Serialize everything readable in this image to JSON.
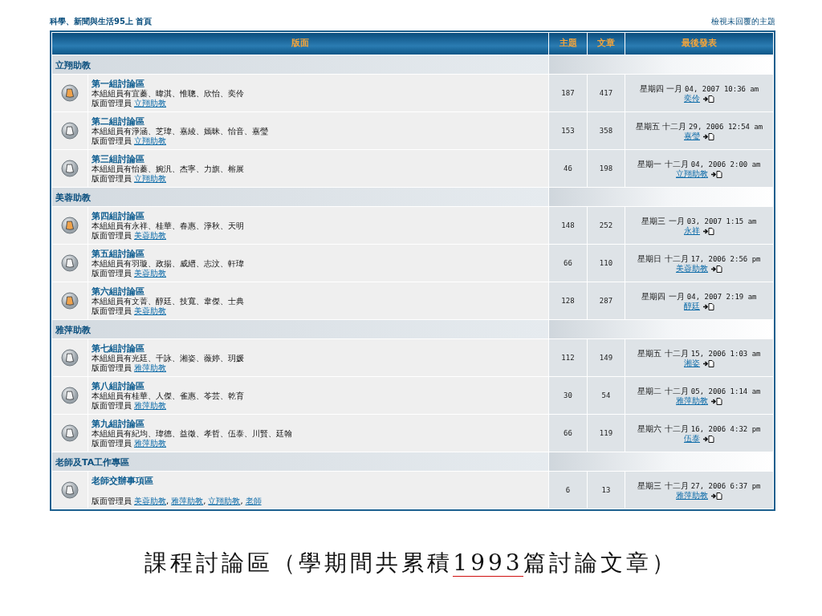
{
  "breadcrumb": "科學、新聞與生活95上 首頁",
  "unanswered_link": "檢視未回覆的主題",
  "table": {
    "columns": [
      "版面",
      "主題",
      "文章",
      "最後發表"
    ],
    "categories": [
      {
        "name": "立翔助教",
        "forums": [
          {
            "title": "第一組討論區",
            "description": "本組組員有宜蓁、暐淇、惟聰、欣怡、奕伶",
            "moderator_label": "版面管理員",
            "moderators": [
              "立翔助教"
            ],
            "topics": "187",
            "posts": "417",
            "last_post_date": "星期四 一月 04, 2007 10:36 am",
            "last_post_author": "奕伶",
            "new_posts": true
          },
          {
            "title": "第二組討論區",
            "description": "本組組員有淨涵、芝瑋、嘉綾、嫣昧、怡音、嘉瑩",
            "moderator_label": "版面管理員",
            "moderators": [
              "立翔助教"
            ],
            "topics": "153",
            "posts": "358",
            "last_post_date": "星期五 十二月 29, 2006 12:54 am",
            "last_post_author": "嘉瑩",
            "new_posts": false
          },
          {
            "title": "第三組討論區",
            "description": "本組組員有怡蓁、婉汎、杰寧、力旗、榕展",
            "moderator_label": "版面管理員",
            "moderators": [
              "立翔助教"
            ],
            "topics": "46",
            "posts": "198",
            "last_post_date": "星期一 十二月 04, 2006 2:00 am",
            "last_post_author": "立翔助教",
            "new_posts": false
          }
        ]
      },
      {
        "name": "美蓉助教",
        "forums": [
          {
            "title": "第四組討論區",
            "description": "本組組員有永祥、桂華、春惠、淨秋、天明",
            "moderator_label": "版面管理員",
            "moderators": [
              "美蓉助教"
            ],
            "topics": "148",
            "posts": "252",
            "last_post_date": "星期三 一月 03, 2007 1:15 am",
            "last_post_author": "永祥",
            "new_posts": true
          },
          {
            "title": "第五組討論區",
            "description": "本組組員有羽璇、政揚、威縉、志汶、軒瑋",
            "moderator_label": "版面管理員",
            "moderators": [
              "美蓉助教"
            ],
            "topics": "66",
            "posts": "110",
            "last_post_date": "星期日 十二月 17, 2006 2:56 pm",
            "last_post_author": "美蓉助教",
            "new_posts": false
          },
          {
            "title": "第六組討論區",
            "description": "本組組員有文菁、醇廷、技寬、韋傑、士典",
            "moderator_label": "版面管理員",
            "moderators": [
              "美蓉助教"
            ],
            "topics": "128",
            "posts": "287",
            "last_post_date": "星期四 一月 04, 2007 2:19 am",
            "last_post_author": "醇廷",
            "new_posts": true
          }
        ]
      },
      {
        "name": "雅萍助教",
        "forums": [
          {
            "title": "第七組討論區",
            "description": "本組組員有光廷、千詠、湘姿、薇婷、玥媛",
            "moderator_label": "版面管理員",
            "moderators": [
              "雅萍助教"
            ],
            "topics": "112",
            "posts": "149",
            "last_post_date": "星期五 十二月 15, 2006 1:03 am",
            "last_post_author": "湘姿",
            "new_posts": false
          },
          {
            "title": "第八組討論區",
            "description": "本組組員有桂華、人傑、雀惠、苓芸、乾育",
            "moderator_label": "版面管理員",
            "moderators": [
              "雅萍助教"
            ],
            "topics": "30",
            "posts": "54",
            "last_post_date": "星期二 十二月 05, 2006 1:14 am",
            "last_post_author": "雅萍助教",
            "new_posts": false
          },
          {
            "title": "第九組討論區",
            "description": "本組組員有紀均、瑋德、益徵、孝哲、伍泰、川賢、廷翰",
            "moderator_label": "版面管理員",
            "moderators": [
              "雅萍助教"
            ],
            "topics": "66",
            "posts": "119",
            "last_post_date": "星期六 十二月 16, 2006 4:32 pm",
            "last_post_author": "伍泰",
            "new_posts": false
          }
        ]
      },
      {
        "name": "老師及TA工作專區",
        "forums": [
          {
            "title": "老師交辦事項區",
            "moderator_label": "版面管理員",
            "moderators": [
              "美蓉助教",
              "雅萍助教",
              "立翔助教",
              "老師"
            ],
            "moderator_separator": ",",
            "topics": "6",
            "posts": "13",
            "last_post_date": "星期三 十二月 27, 2006 6:37 pm",
            "last_post_author": "雅萍助教",
            "new_posts": false
          }
        ]
      }
    ]
  },
  "caption": [
    {
      "text": "課程討論區（學期間共累積",
      "underlined": false
    },
    {
      "text": "1993",
      "underlined": true
    },
    {
      "text": "篇討論文章）",
      "underlined": false
    }
  ]
}
